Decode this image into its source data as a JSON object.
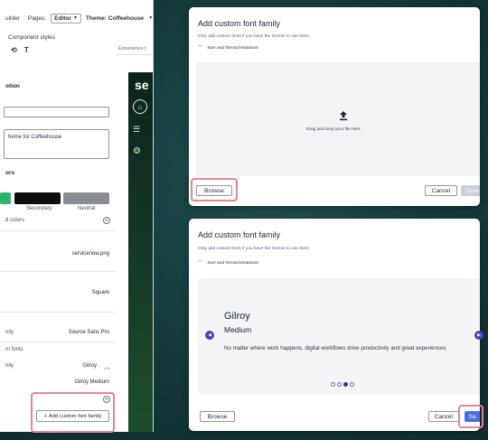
{
  "colors": {
    "highlight": "#e88493",
    "primary_disabled": "#c9cfe0",
    "primary": "#4a6fe0",
    "carousel_active": "#3b2fa0"
  },
  "left_panel": {
    "top": {
      "builder_label": "uilder",
      "pages_label": "Pages:",
      "pages_value": "Editor",
      "theme_label": "Theme: Coffeehouse"
    },
    "tab_component_styles": "Component styles",
    "preview_header": "Experience t",
    "section_description": "otion",
    "description_value": "heme for Coffeehouse",
    "section_colors": "ors",
    "swatches": [
      {
        "label": "",
        "color": "#2db36b"
      },
      {
        "label": "Secondary",
        "color": "#0d0d0d"
      },
      {
        "label": "Neutral",
        "color": "#8a8d91"
      }
    ],
    "add_colors_label": "d colors",
    "logo_value": "servicenow.png",
    "shape_value": "Square",
    "font_family_label": "nily",
    "font_family_value": "Source Sans Pro",
    "custom_fonts_label": "m fonts",
    "custom_font_family_label": "nily",
    "custom_font_value": "Gilroy",
    "custom_font_weight": "Gilroy Medium",
    "add_custom_font_button": "Add custom font family"
  },
  "preview": {
    "logo_text": "se"
  },
  "dialog_top": {
    "title": "Add custom font family",
    "description": "Only add custom fonts if you have the license to use them.",
    "disclosure": "Size and format limitations",
    "drop_text": "Drag and drop your file here",
    "browse_button": "Browse",
    "cancel_button": "Cancel",
    "save_button": "Save"
  },
  "dialog_bottom": {
    "title": "Add custom font family",
    "description": "Only add custom fonts if you have the license to use them.",
    "disclosure": "Size and format limitations",
    "font_name": "Gilroy",
    "font_weight": "Medium",
    "font_sample": "No matter where work happens, digital workflows drive productivity and great experiences",
    "carousel_pages": 4,
    "carousel_active_index": 2,
    "browse_button": "Browse",
    "cancel_button": "Cancel",
    "save_button": "Sa"
  },
  "icons": [
    "text-icon",
    "link-icon",
    "home-icon",
    "menu-icon",
    "settings-icon",
    "upload-icon",
    "chevron-down-icon",
    "chevron-up-icon",
    "plus-icon",
    "arrow-left-icon",
    "arrow-right-icon"
  ]
}
